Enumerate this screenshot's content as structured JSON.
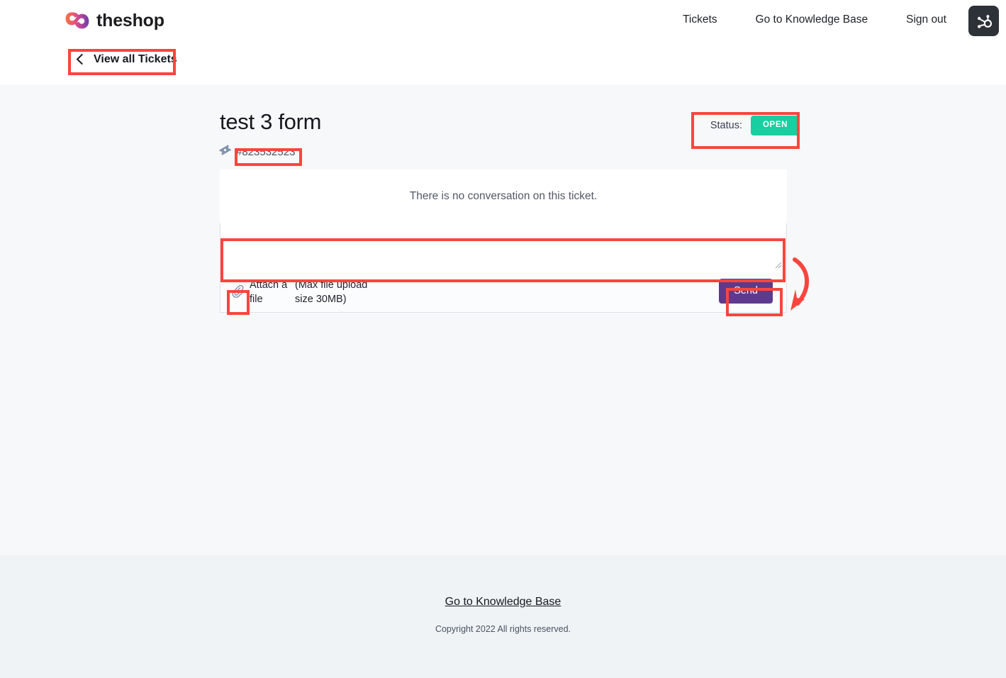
{
  "header": {
    "brand_name": "theshop",
    "brand_logo_icon": "theshop-infinity-logo",
    "nav": [
      {
        "label": "Tickets",
        "name": "nav-tickets"
      },
      {
        "label": "Go to Knowledge Base",
        "name": "nav-knowledge-base"
      },
      {
        "label": "Sign out",
        "name": "nav-sign-out"
      }
    ],
    "hubspot_icon": "hubspot-sprocket-icon"
  },
  "subbar": {
    "back_label": "View all Tickets",
    "back_icon": "chevron-left-icon"
  },
  "ticket": {
    "title": "test 3 form",
    "id": "#823532523",
    "id_icon": "ticket-tag-icon",
    "status_label": "Status:",
    "status_value": "OPEN",
    "conversation_empty": "There is no conversation on this ticket."
  },
  "reply": {
    "textarea_value": "",
    "textarea_placeholder": "",
    "attach_icon": "paperclip-icon",
    "attach_label": "Attach a file",
    "max_size_label": "(Max file upload size 30MB)",
    "send_label": "Send"
  },
  "footer": {
    "link_label": "Go to Knowledge Base",
    "copyright": "Copyright 2022 All rights reserved."
  },
  "colors": {
    "status_open": "#17cfa0",
    "send_button": "#5d3a8e",
    "annotation": "#f9453e",
    "page_bg": "#f7f8fa",
    "footer_bg": "#eff3f6"
  }
}
